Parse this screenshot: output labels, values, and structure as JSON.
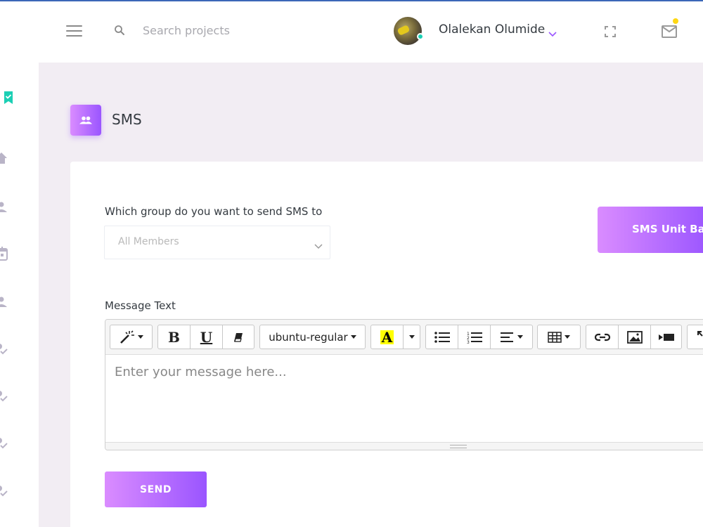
{
  "header": {
    "search_placeholder": "Search projects",
    "user_name": "Olalekan Olumide"
  },
  "page": {
    "title": "SMS"
  },
  "form": {
    "group_label": "Which group do you want to send SMS to",
    "group_select_value": "All Members",
    "sms_unit_button": "SMS Unit Ba",
    "message_label": "Message Text",
    "message_placeholder": "Enter your message here...",
    "font_family_value": "ubuntu-regular",
    "send_button": "SEND"
  },
  "sidebar": {
    "icons": [
      "check-badge-icon",
      "home-icon",
      "people-icon",
      "calendar-icon",
      "people-icon",
      "user-check-icon",
      "user-check-icon",
      "user-check-icon",
      "user-check-icon"
    ]
  },
  "colors": {
    "accent_gradient_start": "#da8cff",
    "accent_gradient_end": "#9a55ff",
    "status_online": "#1bcfb4",
    "notification_dot": "#fed713",
    "sidebar_active": "#1bcfb4",
    "top_strip": "#3b67b8"
  }
}
